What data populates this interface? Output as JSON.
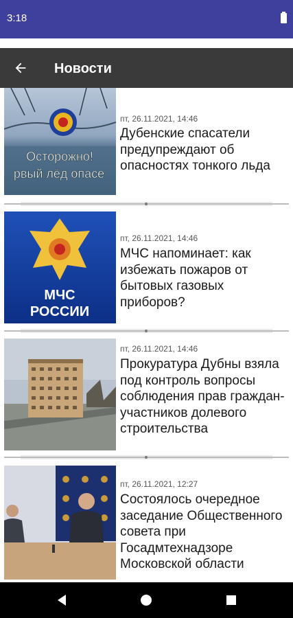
{
  "status_bar": {
    "time": "3:18"
  },
  "app_bar": {
    "title": "Новости",
    "back_icon": "arrow-left-icon"
  },
  "news": [
    {
      "date": "пт, 26.11.2021, 14:46",
      "title": "Дубенские спасатели предупреждают об опасностях тонкого льда",
      "image_caption_1": "Осторожно!",
      "image_caption_2": "рвый лёд опасе"
    },
    {
      "date": "пт, 26.11.2021, 14:46",
      "title": "МЧС напоминает: как избежать пожаров от бытовых газовых приборов?",
      "image_caption_1": "МЧС",
      "image_caption_2": "РОССИИ"
    },
    {
      "date": "пт, 26.11.2021, 14:46",
      "title": "Прокуратура Дубны взяла под контроль вопросы соблюдения прав граждан-участников долевого строительства"
    },
    {
      "date": "пт, 26.11.2021, 12:27",
      "title": "Состоялось очередное заседание Общественного совета при Госадмтехнадзоре Московской области"
    }
  ],
  "nav_bar": {
    "back": "triangle-back-icon",
    "home": "circle-home-icon",
    "recents": "square-recents-icon"
  }
}
